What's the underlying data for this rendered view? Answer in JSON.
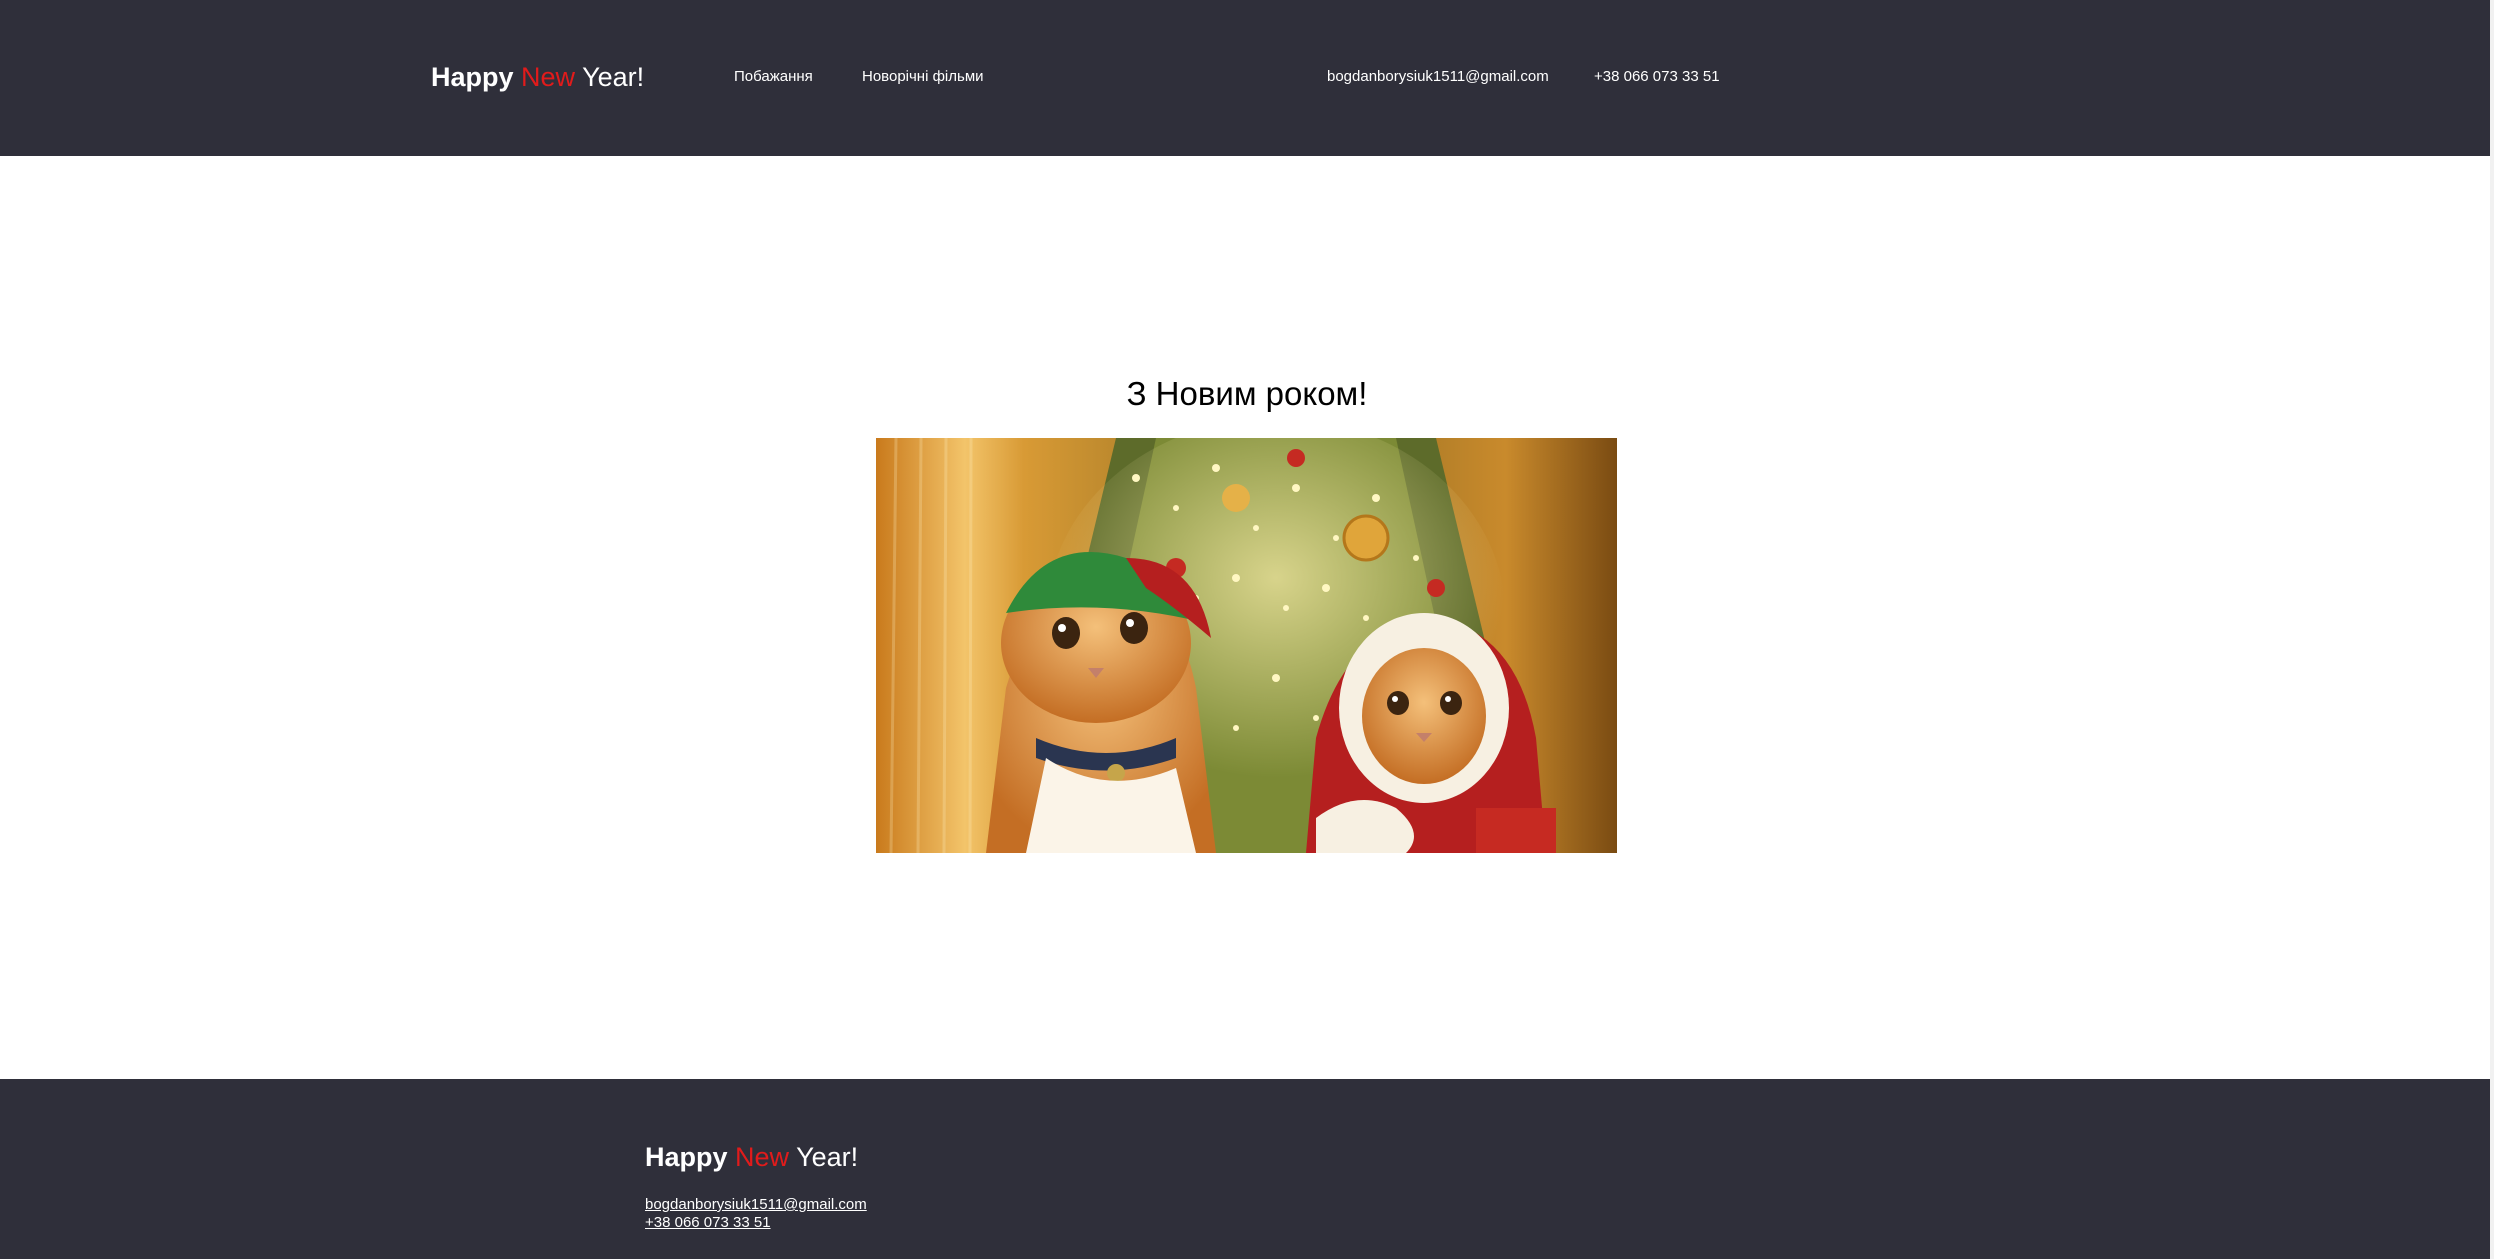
{
  "header": {
    "logo": {
      "part1": "Happy",
      "part2": "New",
      "part3": "Year!"
    },
    "nav": [
      {
        "label": "Побажання"
      },
      {
        "label": "Новорічні фільми"
      }
    ],
    "contacts": {
      "email": "bogdanborysiuk1511@gmail.com",
      "phone": "+38 066 073 33 51"
    }
  },
  "main": {
    "title": "З Новим роком!",
    "image": {
      "alt": "Two cats in Christmas hats in front of a decorated Christmas tree"
    }
  },
  "footer": {
    "logo": {
      "part1": "Happy",
      "part2": "New",
      "part3": "Year!"
    },
    "email": "bogdanborysiuk1511@gmail.com",
    "phone": "+38 066 073 33 51"
  },
  "colors": {
    "bar_background": "#2f2f3a",
    "accent_red": "#e11b1b",
    "text_light": "#ffffff"
  }
}
